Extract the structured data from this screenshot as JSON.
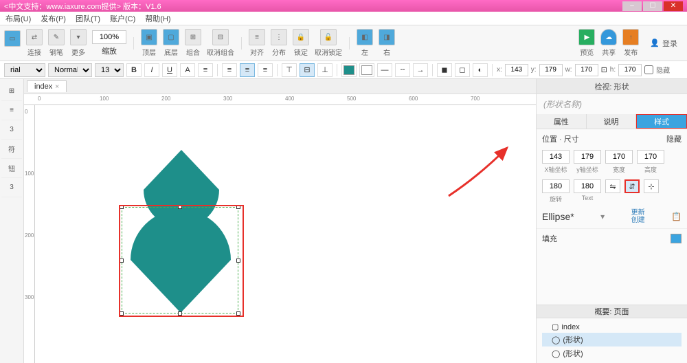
{
  "title_suffix": "<中文支持：www.iaxure.com提供> 版本：V1.6",
  "menu": {
    "layout": "布局(U)",
    "publish": "发布(P)",
    "team": "团队(T)",
    "account": "账户(C)",
    "help": "帮助(H)"
  },
  "toolbar": {
    "connect": "连接",
    "pen": "钢笔",
    "more": "更多",
    "zoom_val": "100%",
    "zoom_lbl": "缩放",
    "top": "顶层",
    "bottom": "底层",
    "group": "组合",
    "ungroup": "取消组合",
    "align": "对齐",
    "distribute": "分布",
    "lock": "锁定",
    "unlock": "取消锁定",
    "left": "左",
    "right": "右",
    "preview": "预览",
    "share": "共享",
    "publish": "发布",
    "login": "登录"
  },
  "format": {
    "font": "rial",
    "weight": "Normal",
    "size": "13",
    "x_lbl": "x:",
    "x": "143",
    "y_lbl": "y:",
    "y": "179",
    "w_lbl": "w:",
    "w": "170",
    "h_lbl": "h:",
    "h": "170",
    "hidden": "隐藏"
  },
  "tabs": {
    "main": "index"
  },
  "ruler_h": [
    "0",
    "100",
    "200",
    "300",
    "400",
    "500",
    "600",
    "700"
  ],
  "ruler_v": [
    "0",
    "100",
    "200",
    "300"
  ],
  "left_items": [
    "",
    "≡",
    "",
    "3",
    "符",
    "钮",
    "3"
  ],
  "inspector": {
    "header": "检视: 形状",
    "name_placeholder": "(形状名称)",
    "tab_props": "属性",
    "tab_notes": "说明",
    "tab_style": "样式",
    "pos_title": "位置 · 尺寸",
    "hidden": "隐藏",
    "x": "143",
    "x_lbl": "X轴坐标",
    "y": "179",
    "y_lbl": "y轴坐标",
    "w": "170",
    "w_lbl": "宽度",
    "h": "170",
    "h_lbl": "高度",
    "rot": "180",
    "rot_lbl": "旋转",
    "text": "180",
    "text_lbl": "Text",
    "style_name": "Ellipse*",
    "update": "更新",
    "create": "创建",
    "fill": "填充"
  },
  "outline": {
    "header": "概要: 页面",
    "page": "index",
    "item1": "(形状)",
    "item2": "(形状)"
  },
  "colors": {
    "shape": "#1e8f8a",
    "accent": "#3ba4e0",
    "red": "#e7302a"
  }
}
